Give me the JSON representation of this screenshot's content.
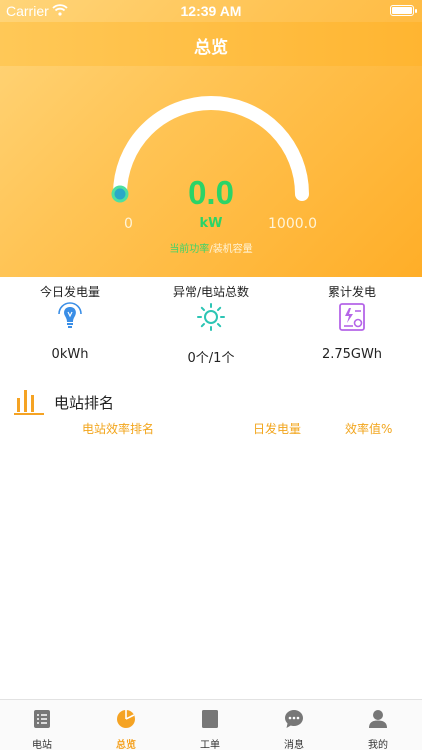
{
  "status_bar": {
    "carrier": "Carrier",
    "time": "12:39 AM"
  },
  "nav": {
    "title": "总览"
  },
  "gauge": {
    "value": "0.0",
    "unit": "kW",
    "min": "0",
    "max": "1000.0",
    "legend_current": "当前功率",
    "legend_sep": "/",
    "legend_capacity": "装机容量",
    "fraction": 0
  },
  "stats": [
    {
      "label": "今日发电量",
      "value": "0kWh",
      "icon": "lightbulb-icon",
      "color": "#3a8ee6"
    },
    {
      "label": "异常/电站总数",
      "value": "0个/1个",
      "icon": "sun-icon",
      "color": "#2cc5b4"
    },
    {
      "label": "累计发电",
      "value": "2.75GWh",
      "icon": "energy-certificate-icon",
      "color": "#b565e8"
    }
  ],
  "ranking": {
    "title": "电站排名",
    "columns": [
      "电站效率排名",
      "日发电量",
      "效率值%"
    ]
  },
  "tabbar": {
    "items": [
      {
        "label": "电站",
        "icon": "list-icon",
        "active": false
      },
      {
        "label": "总览",
        "icon": "pie-chart-icon",
        "active": true
      },
      {
        "label": "工单",
        "icon": "document-icon",
        "active": false
      },
      {
        "label": "消息",
        "icon": "chat-bubble-icon",
        "active": false
      },
      {
        "label": "我的",
        "icon": "person-icon",
        "active": false
      }
    ]
  },
  "colors": {
    "accent": "#f5a323",
    "green": "#2bd467"
  }
}
